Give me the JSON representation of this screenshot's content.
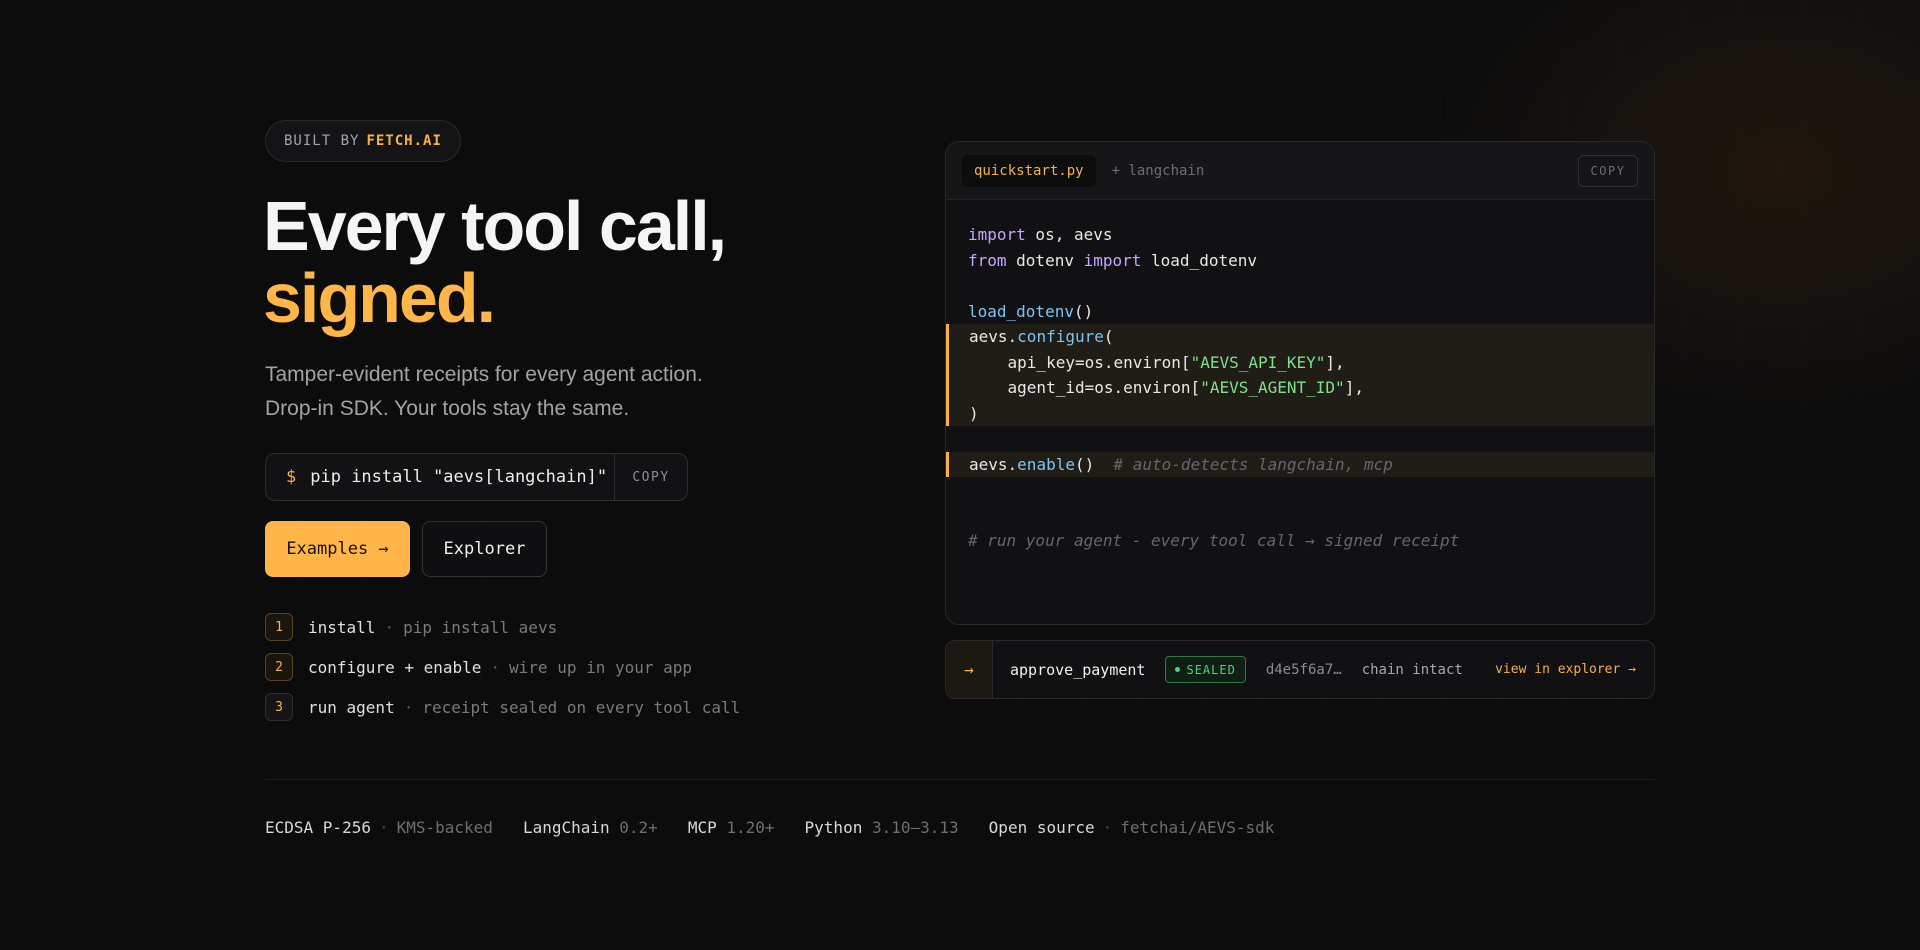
{
  "badge": {
    "prefix": "BUILT BY",
    "brand": "FETCH.AI"
  },
  "hero": {
    "line1": "Every tool call,",
    "line2": "signed."
  },
  "subtitle": {
    "line1": "Tamper-evident receipts for every agent action.",
    "line2": "Drop-in SDK. Your tools stay the same."
  },
  "install": {
    "prompt": "$",
    "command": "pip install \"aevs[langchain]\"",
    "copy_label": "COPY"
  },
  "buttons": {
    "examples": "Examples →",
    "explorer": "Explorer"
  },
  "steps": [
    {
      "num": "1",
      "name": "install",
      "desc": "pip install aevs"
    },
    {
      "num": "2",
      "name": "configure + enable",
      "desc": "wire up in your app"
    },
    {
      "num": "3",
      "name": "run agent",
      "desc": "receipt sealed on every tool call"
    }
  ],
  "code_panel": {
    "tab_active": "quickstart.py",
    "tab_extra": "+ langchain",
    "copy_label": "COPY",
    "code": {
      "import_kw": "import",
      "import_rest": " os, aevs",
      "from_kw": "from",
      "from_mod": " dotenv ",
      "from_import_kw": "import",
      "from_rest": " load_dotenv",
      "load_fn": "load_dotenv",
      "load_rest": "()",
      "cfg_obj": "aevs.",
      "cfg_fn": "configure",
      "cfg_open": "(",
      "api_pre": "    api_key=os.environ[",
      "api_str": "\"AEVS_API_KEY\"",
      "api_post": "],",
      "agent_pre": "    agent_id=os.environ[",
      "agent_str": "\"AEVS_AGENT_ID\"",
      "agent_post": "],",
      "cfg_close": ")",
      "enable_obj": "aevs.",
      "enable_fn": "enable",
      "enable_rest": "()  ",
      "enable_comment": "# auto-detects langchain, mcp",
      "final_comment": "# run your agent - every tool call → signed receipt"
    }
  },
  "receipt": {
    "arrow": "→",
    "tool": "approve_payment",
    "status": "SEALED",
    "hash": "d4e5f6a7…",
    "integrity": "chain intact",
    "link": "view in explorer →"
  },
  "footer": [
    {
      "key": "ECDSA P-256",
      "sep": "·",
      "value": "KMS-backed"
    },
    {
      "key": "LangChain",
      "sep": "",
      "value": "0.2+"
    },
    {
      "key": "MCP",
      "sep": "",
      "value": "1.20+"
    },
    {
      "key": "Python",
      "sep": "",
      "value": "3.10–3.13"
    },
    {
      "key": "Open source",
      "sep": "·",
      "value": "fetchai/AEVS-sdk"
    }
  ],
  "colors": {
    "accent": "#ffb547",
    "sealed": "#4fd27a",
    "background": "#0c0c0d"
  }
}
